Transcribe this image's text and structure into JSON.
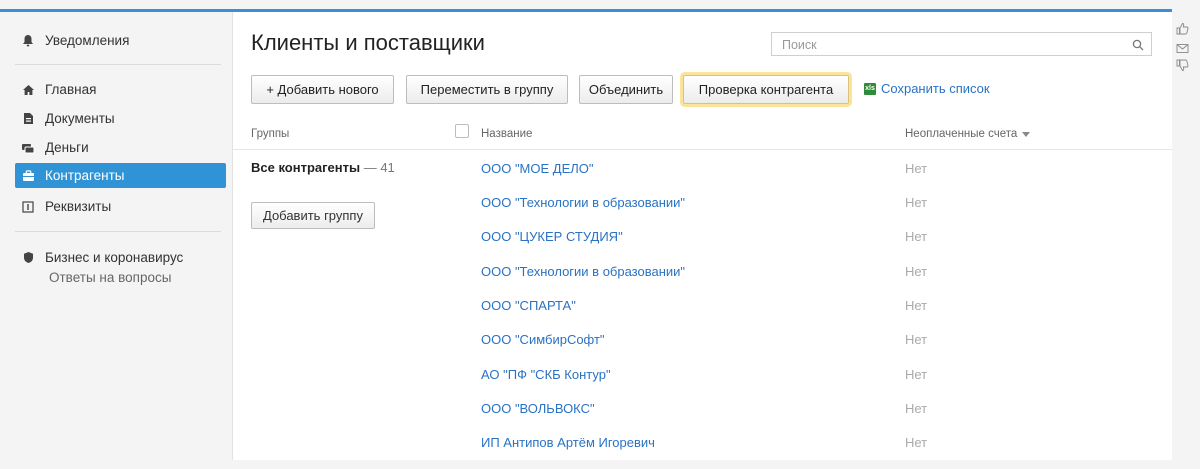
{
  "sidebar": {
    "notifications": "Уведомления",
    "items": [
      {
        "label": "Главная",
        "icon": "home-icon"
      },
      {
        "label": "Документы",
        "icon": "document-icon"
      },
      {
        "label": "Деньги",
        "icon": "money-icon"
      },
      {
        "label": "Контрагенты",
        "icon": "briefcase-icon",
        "active": true
      },
      {
        "label": "Реквизиты",
        "icon": "details-icon"
      }
    ],
    "promo": {
      "title": "Бизнес и коронавирус",
      "subtitle": "Ответы на вопросы"
    }
  },
  "header": {
    "title": "Клиенты и поставщики",
    "search_placeholder": "Поиск"
  },
  "toolbar": {
    "add_new": "+ Добавить нового",
    "move_to_group": "Переместить в группу",
    "merge": "Объединить",
    "check_counterparty": "Проверка контрагента",
    "save_list": "Сохранить список"
  },
  "columns": {
    "groups": "Группы",
    "name": "Название",
    "unpaid": "Неоплаченные счета"
  },
  "groups": {
    "all_label": "Все контрагенты",
    "all_sep": " — ",
    "all_count": "41",
    "add_group": "Добавить группу"
  },
  "rows": [
    {
      "name": "ООО \"МОЕ ДЕЛО\"",
      "unpaid": "Нет"
    },
    {
      "name": "ООО \"Технологии в образовании\"",
      "unpaid": "Нет"
    },
    {
      "name": "ООО \"ЦУКЕР СТУДИЯ\"",
      "unpaid": "Нет"
    },
    {
      "name": "ООО \"Технологии в образовании\"",
      "unpaid": "Нет"
    },
    {
      "name": "ООО \"СПАРТА\"",
      "unpaid": "Нет"
    },
    {
      "name": "ООО \"СимбирСофт\"",
      "unpaid": "Нет"
    },
    {
      "name": "АО \"ПФ \"СКБ Контур\"",
      "unpaid": "Нет"
    },
    {
      "name": "ООО \"ВОЛЬВОКС\"",
      "unpaid": "Нет"
    },
    {
      "name": "ИП Антипов Артём Игоревич",
      "unpaid": "Нет"
    }
  ],
  "colors": {
    "accent": "#2f93d6",
    "link": "#2a72c4",
    "highlight": "#fbe39a"
  }
}
